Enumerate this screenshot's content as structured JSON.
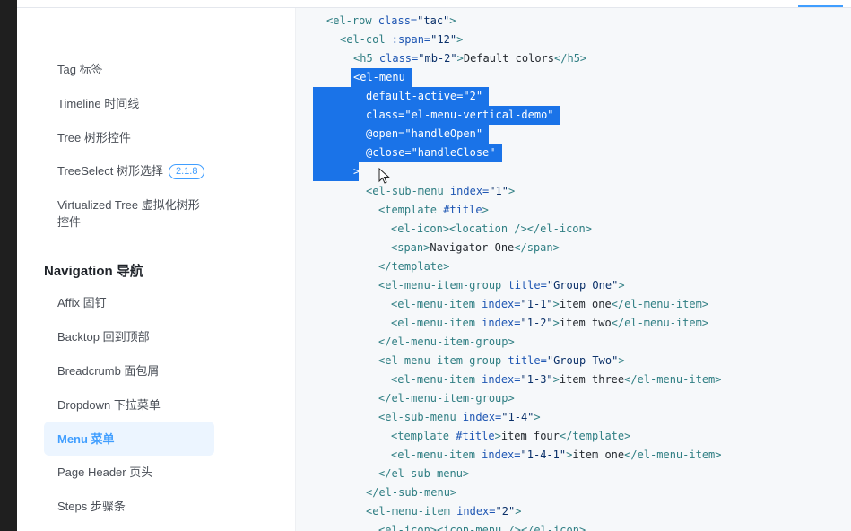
{
  "sidebar": {
    "items": [
      {
        "label": "Tag 标签"
      },
      {
        "label": "Timeline 时间线"
      },
      {
        "label": "Tree 树形控件"
      },
      {
        "label": "TreeSelect 树形选择",
        "badge": "2.1.8"
      },
      {
        "label": "Virtualized Tree 虚拟化树形",
        "label2": "控件"
      }
    ],
    "section_title": "Navigation 导航",
    "nav_items": [
      {
        "label": "Affix 固钉"
      },
      {
        "label": "Backtop 回到顶部"
      },
      {
        "label": "Breadcrumb 面包屑"
      },
      {
        "label": "Dropdown 下拉菜单"
      },
      {
        "label": "Menu 菜单"
      },
      {
        "label": "Page Header 页头"
      },
      {
        "label": "Steps 步骤条"
      }
    ]
  },
  "code": {
    "l1": {
      "open": "<el-row ",
      "attr": "class=",
      "val": "\"tac\"",
      "close": ">"
    },
    "l2": {
      "open": "<el-col ",
      "attr": ":span=",
      "val": "\"12\"",
      "close": ">"
    },
    "l3": {
      "open": "<h5 ",
      "attr": "class=",
      "val": "\"mb-2\"",
      "close": ">",
      "text": "Default colors",
      "end": "</h5>"
    },
    "l4": {
      "open": "<el-menu"
    },
    "l5": {
      "attr": "default-active=",
      "val": "\"2\""
    },
    "l6": {
      "attr": "class=",
      "val": "\"el-menu-vertical-demo\""
    },
    "l7": {
      "attr": "@open=",
      "val": "\"handleOpen\""
    },
    "l8": {
      "attr": "@close=",
      "val": "\"handleClose\""
    },
    "l9": {
      "close": ">"
    },
    "l10": {
      "open": "<el-sub-menu ",
      "attr": "index=",
      "val": "\"1\"",
      "close": ">"
    },
    "l11": {
      "open": "<template ",
      "attr": "#title",
      "close": ">"
    },
    "l12": {
      "open": "<el-icon>",
      "inner": "<location />",
      "end": "</el-icon>"
    },
    "l13": {
      "open": "<span>",
      "text": "Navigator One",
      "end": "</span>"
    },
    "l14": {
      "end": "</template>"
    },
    "l15": {
      "open": "<el-menu-item-group ",
      "attr": "title=",
      "val": "\"Group One\"",
      "close": ">"
    },
    "l16": {
      "open": "<el-menu-item ",
      "attr": "index=",
      "val": "\"1-1\"",
      "close": ">",
      "text": "item one",
      "end": "</el-menu-item>"
    },
    "l17": {
      "open": "<el-menu-item ",
      "attr": "index=",
      "val": "\"1-2\"",
      "close": ">",
      "text": "item two",
      "end": "</el-menu-item>"
    },
    "l18": {
      "end": "</el-menu-item-group>"
    },
    "l19": {
      "open": "<el-menu-item-group ",
      "attr": "title=",
      "val": "\"Group Two\"",
      "close": ">"
    },
    "l20": {
      "open": "<el-menu-item ",
      "attr": "index=",
      "val": "\"1-3\"",
      "close": ">",
      "text": "item three",
      "end": "</el-menu-item>"
    },
    "l21": {
      "end": "</el-menu-item-group>"
    },
    "l22": {
      "open": "<el-sub-menu ",
      "attr": "index=",
      "val": "\"1-4\"",
      "close": ">"
    },
    "l23": {
      "open": "<template ",
      "attr": "#title",
      "close": ">",
      "text": "item four",
      "end": "</template>"
    },
    "l24": {
      "open": "<el-menu-item ",
      "attr": "index=",
      "val": "\"1-4-1\"",
      "close": ">",
      "text": "item one",
      "end": "</el-menu-item>"
    },
    "l25": {
      "end": "</el-sub-menu>"
    },
    "l26": {
      "end": "</el-sub-menu>"
    },
    "l27": {
      "open": "<el-menu-item ",
      "attr": "index=",
      "val": "\"2\"",
      "close": ">"
    },
    "l28": {
      "open": "<el-icon>",
      "inner": "<icon-menu />",
      "end": "</el-icon>"
    }
  },
  "colors": {
    "accent": "#409eff",
    "selection": "#1a73e8",
    "tag": "#2f7e83",
    "attr": "#1e56b3"
  }
}
